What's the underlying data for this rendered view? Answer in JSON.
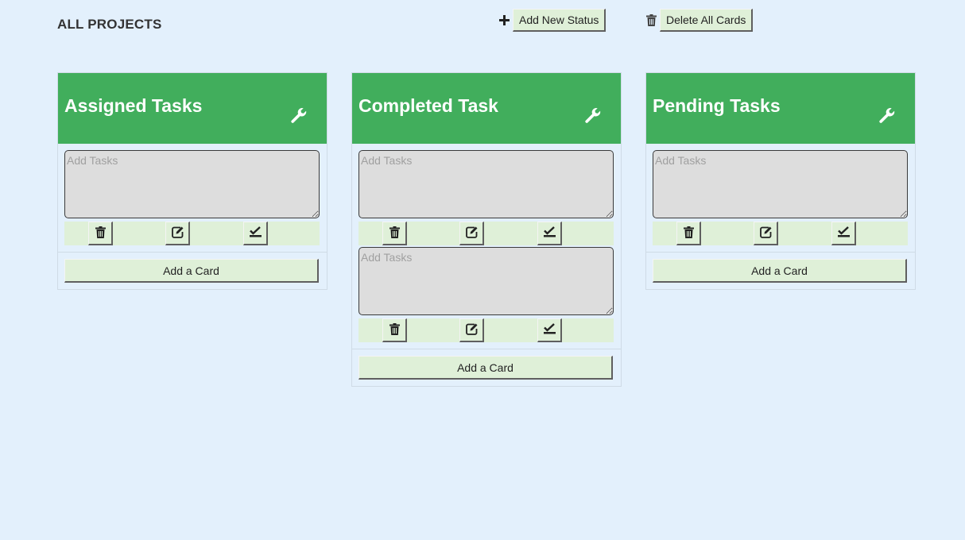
{
  "header": {
    "title": "ALL PROJECTS",
    "add_status_label": "Add New Status",
    "delete_all_label": "Delete All Cards"
  },
  "icons": {
    "add_status": "plus-icon",
    "delete_all": "trash-icon",
    "column_settings": "wrench-icon",
    "card_delete": "trash-icon",
    "card_edit": "edit-icon",
    "card_done": "check-icon"
  },
  "colors": {
    "page_background": "#e3f0fc",
    "column_header": "#41ae5c",
    "button_background": "#dff0d8",
    "textarea_background": "#dddddd"
  },
  "columns": [
    {
      "title": "Assigned Tasks",
      "cards": [
        {
          "placeholder": "Add Tasks",
          "value": ""
        }
      ],
      "add_card_label": "Add a Card"
    },
    {
      "title": "Completed Task",
      "cards": [
        {
          "placeholder": "Add Tasks",
          "value": ""
        },
        {
          "placeholder": "Add Tasks",
          "value": ""
        }
      ],
      "add_card_label": "Add a Card"
    },
    {
      "title": "Pending Tasks",
      "cards": [
        {
          "placeholder": "Add Tasks",
          "value": ""
        }
      ],
      "add_card_label": "Add a Card"
    }
  ]
}
